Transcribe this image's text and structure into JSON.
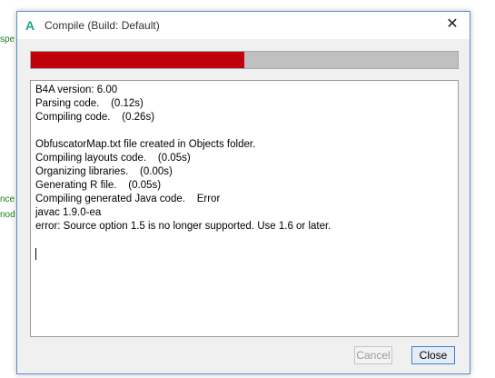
{
  "background": {
    "fragments": [
      "spe",
      "nce",
      "nod"
    ]
  },
  "window": {
    "app_icon": "A",
    "title": "Compile (Build: Default)",
    "close_glyph": "✕"
  },
  "progress": {
    "value": 0.5,
    "fill_color": "#c0000a",
    "track_color": "#c0c0c0"
  },
  "log": {
    "lines": [
      "B4A version: 6.00",
      "Parsing code.    (0.12s)",
      "Compiling code.    (0.26s)",
      "",
      "ObfuscatorMap.txt file created in Objects folder.",
      "Compiling layouts code.    (0.05s)",
      "Organizing libraries.    (0.00s)",
      "Generating R file.    (0.05s)",
      "Compiling generated Java code.    Error",
      "javac 1.9.0-ea",
      "error: Source option 1.5 is no longer supported. Use 1.6 or later."
    ]
  },
  "buttons": {
    "cancel_label": "Cancel",
    "close_label": "Close"
  }
}
